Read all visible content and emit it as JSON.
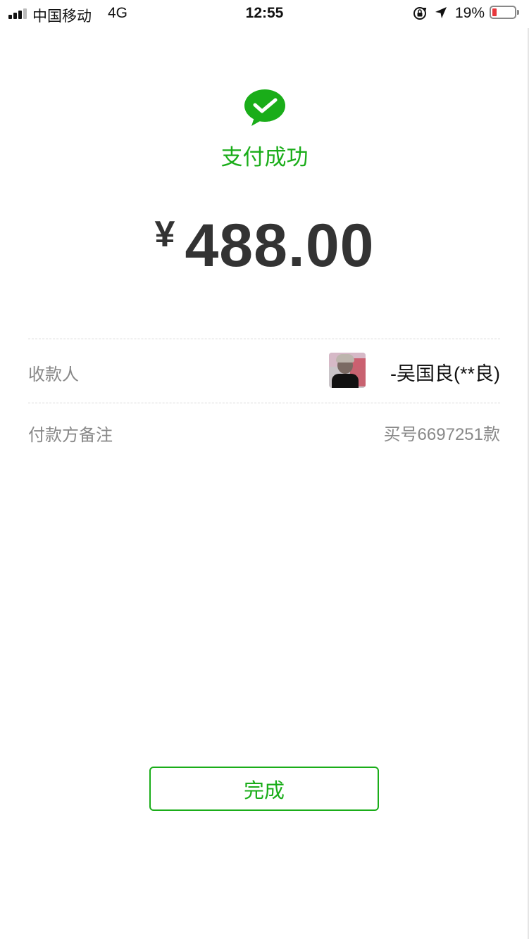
{
  "status_bar": {
    "carrier": "中国移动",
    "network": "4G",
    "time": "12:55",
    "battery_percent": "19%",
    "battery_level": 0.19,
    "icons": [
      "signal-icon",
      "orientation-lock-icon",
      "location-arrow-icon",
      "battery-icon"
    ]
  },
  "result": {
    "icon": "wechat-pay-icon",
    "title": "支付成功",
    "currency": "¥",
    "amount": "488.00"
  },
  "details": {
    "payee_label": "收款人",
    "payee_name": "-吴国良(**良)",
    "remark_label": "付款方备注",
    "remark_value": "买号6697251款"
  },
  "actions": {
    "done_label": "完成"
  },
  "colors": {
    "accent": "#1aad19",
    "amount_text": "#333333",
    "secondary_text": "#888888",
    "battery_low": "#e8383d"
  }
}
